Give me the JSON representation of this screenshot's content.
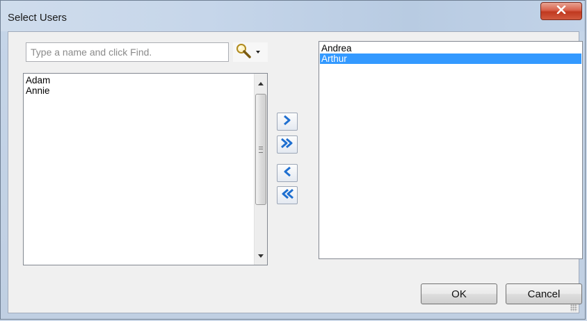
{
  "window": {
    "title": "Select Users"
  },
  "search": {
    "placeholder": "Type a name and click Find.",
    "value": ""
  },
  "left_list": {
    "items": [
      "Adam",
      "Annie"
    ]
  },
  "right_list": {
    "items": [
      "Andrea",
      "Arthur"
    ],
    "selected_index": 1
  },
  "transfer_buttons": {
    "add_icon": "chevron-right-icon",
    "add_all_icon": "double-chevron-right-icon",
    "remove_icon": "chevron-left-icon",
    "remove_all_icon": "double-chevron-left-icon"
  },
  "footer": {
    "ok_label": "OK",
    "cancel_label": "Cancel"
  },
  "colors": {
    "selection": "#3399ff",
    "close_button": "#c7432a",
    "arrow_blue": "#1f6fd0"
  }
}
